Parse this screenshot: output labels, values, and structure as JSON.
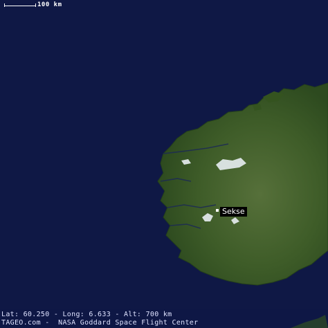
{
  "scale": {
    "label": "100 km"
  },
  "place": {
    "name": "Sekse"
  },
  "footer": {
    "coordinates": "Lat: 60.250 - Long: 6.633 - Alt: 700 km",
    "credit": "TAGEO.com -  NASA Goddard Space Flight Center"
  },
  "colors": {
    "ocean": "#0f1845",
    "land": "#3f5e2a",
    "snow": "#e8eef2"
  }
}
